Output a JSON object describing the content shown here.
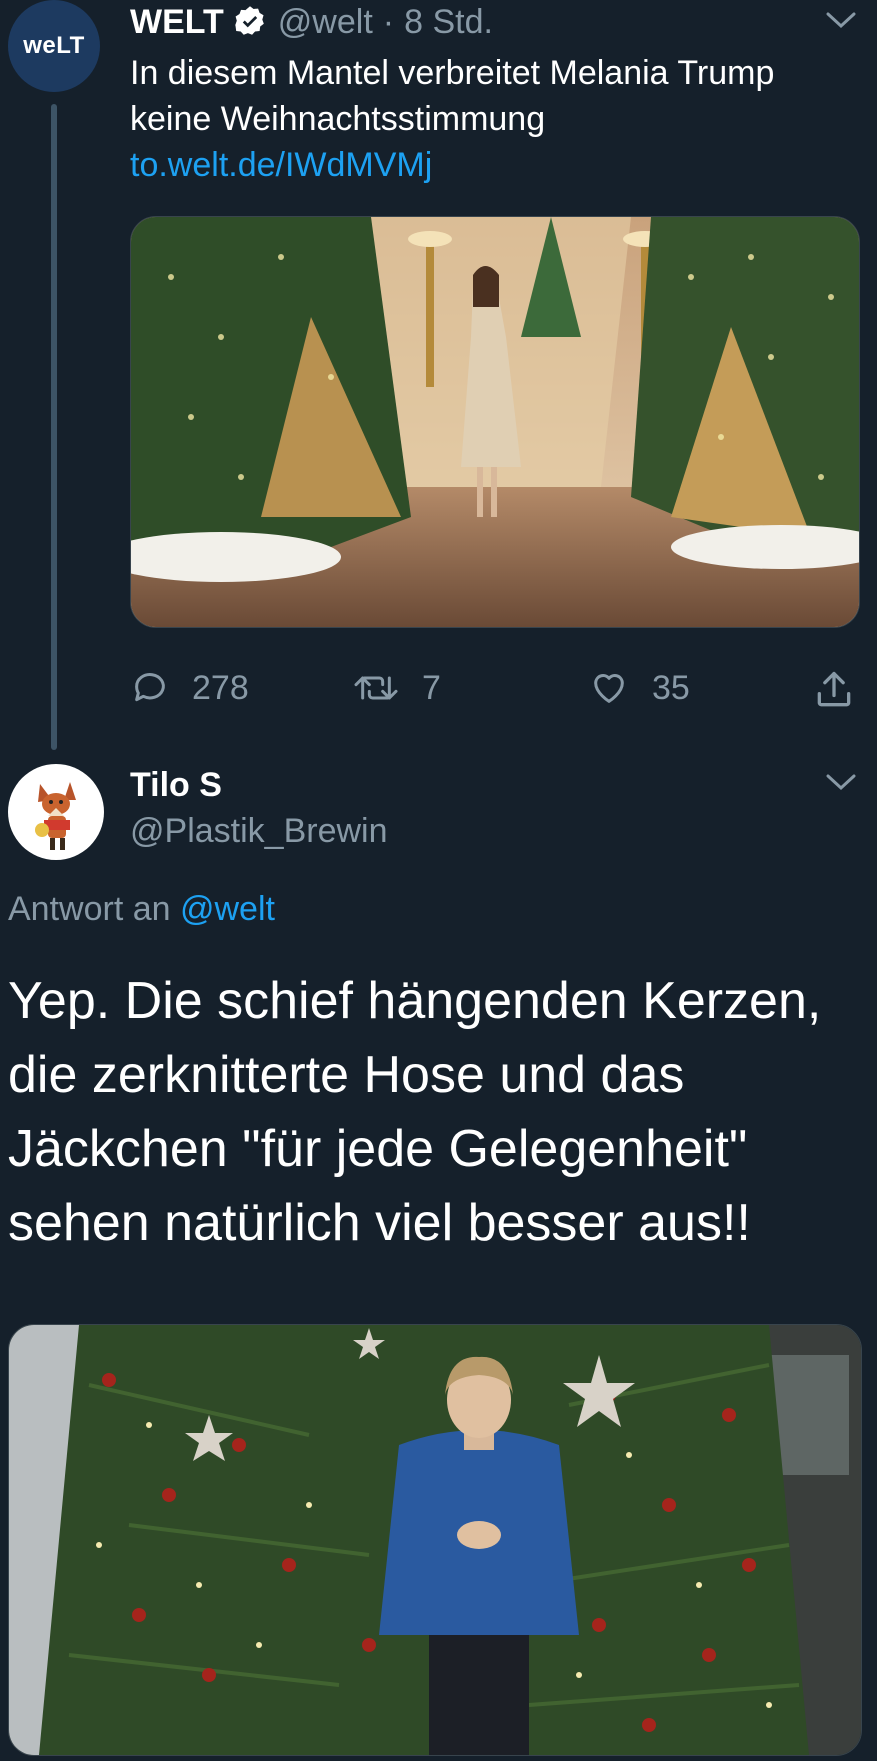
{
  "tweet1": {
    "avatar_text": "weLT",
    "name": "WELT",
    "handle": "@welt",
    "dot": "·",
    "time": "8 Std.",
    "text_line1": "In diesem Mantel verbreitet Melania Trump",
    "text_line2": "keine Weihnachtsstimmung",
    "link": "to.welt.de/IWdMVMj",
    "replies": "278",
    "retweets": "7",
    "likes": "35"
  },
  "tweet2": {
    "name": "Tilo S",
    "handle": "@Plastik_Brewin",
    "reply_prefix": "Antwort an",
    "reply_to": "@welt",
    "text_lines": [
      "Yep. Die schief hängenden Kerzen,",
      "die zerknitterte Hose und das",
      "Jäckchen \"für jede Gelegenheit\"",
      "sehen natürlich viel besser aus!!"
    ]
  },
  "colors": {
    "background": "#15202b",
    "secondary_text": "#8899a6",
    "link": "#1da1f2",
    "thread_line": "#3d5466"
  }
}
